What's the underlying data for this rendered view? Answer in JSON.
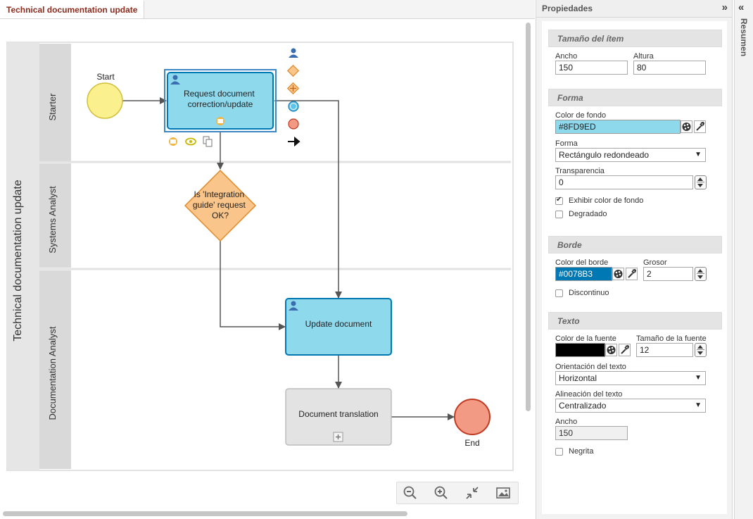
{
  "editor": {
    "tab_title": "Technical documentation update"
  },
  "diagram": {
    "pool_label": "Technical documentation update",
    "lanes": {
      "starter": "Starter",
      "systems": "Systems Analyst",
      "docs": "Documentation Analyst"
    },
    "start_label": "Start",
    "end_label": "End",
    "task1": [
      "Request document",
      "correction/update"
    ],
    "gateway": [
      "Is 'Integration",
      "guide' request",
      "OK?"
    ],
    "task2": "Update document",
    "task3": "Document translation"
  },
  "properties": {
    "title": "Propiedades",
    "size": {
      "section": "Tamaño del ítem",
      "width_label": "Ancho",
      "width": "150",
      "height_label": "Altura",
      "height": "80"
    },
    "shape": {
      "section": "Forma",
      "bg_label": "Color de fondo",
      "bg_value": "#8FD9ED",
      "shape_label": "Forma",
      "shape_value": "Rectángulo redondeado",
      "transp_label": "Transparencia",
      "transp_value": "0",
      "show_bg": "Exhibir color de fondo",
      "gradient": "Degradado"
    },
    "border": {
      "section": "Borde",
      "color_label": "Color del borde",
      "color_value": "#0078B3",
      "thick_label": "Grosor",
      "thick_value": "2",
      "dashed": "Discontinuo"
    },
    "text": {
      "section": "Texto",
      "font_color_label": "Color de la fuente",
      "font_size_label": "Tamaño de la fuente",
      "font_size": "12",
      "orient_label": "Orientación del texto",
      "orient_value": "Horizontal",
      "align_label": "Alineación del texto",
      "align_value": "Centralizado",
      "width_label": "Ancho",
      "width_value": "150",
      "bold": "Negrita"
    }
  },
  "summary": {
    "title": "Resumen"
  },
  "colors": {
    "task_fill": "#8FD9ED",
    "task_border": "#0078B3",
    "font_color": "#000000"
  }
}
